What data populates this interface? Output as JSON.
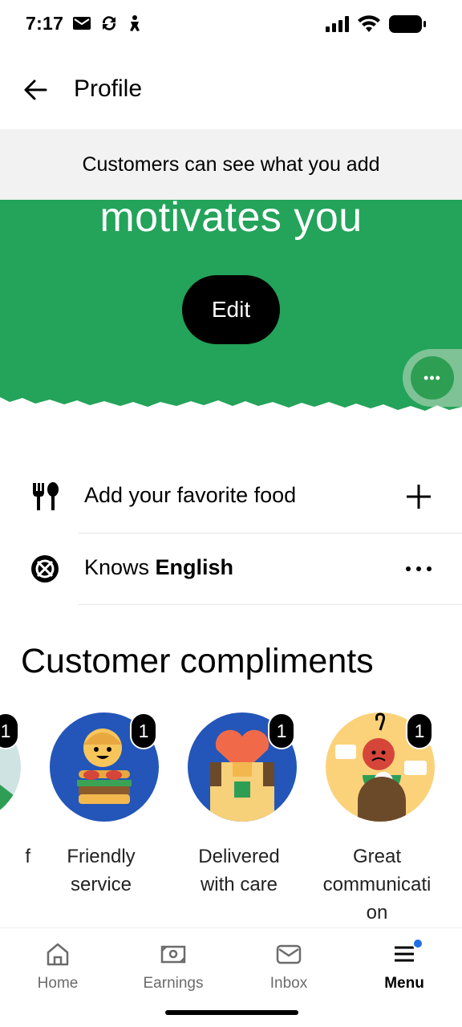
{
  "status_bar": {
    "time": "7:17",
    "left_icons": [
      "mail-icon",
      "sync-icon",
      "accessibility-icon"
    ],
    "right_icons": [
      "signal-icon",
      "wifi-icon",
      "battery-icon"
    ]
  },
  "header": {
    "title": "Profile"
  },
  "notice": {
    "text": "Customers can see what you add"
  },
  "hero": {
    "text": "motivates you",
    "edit_label": "Edit",
    "background_color": "#24a35a",
    "more_label": "•••"
  },
  "rows": [
    {
      "icon": "fork-spoon-icon",
      "label": "Add your favorite food",
      "label_bold": "",
      "action_icon": "plus-icon"
    },
    {
      "icon": "language-icon",
      "label": "Knows ",
      "label_bold": "English",
      "action_icon": "more-horizontal-icon"
    }
  ],
  "compliments": {
    "title": "Customer compliments",
    "items": [
      {
        "label": "",
        "count": "1",
        "color": "#cfe3e3"
      },
      {
        "label": "Friendly service",
        "count": "1",
        "color": "#2356b8"
      },
      {
        "label": "Delivered with care",
        "count": "1",
        "color": "#2356b8"
      },
      {
        "label": "Great communication",
        "count": "1",
        "color": "#fbd27a"
      }
    ],
    "cut_label_tail": "f"
  },
  "bottom_nav": {
    "items": [
      {
        "label": "Home",
        "icon": "home-icon",
        "active": false
      },
      {
        "label": "Earnings",
        "icon": "earnings-icon",
        "active": false
      },
      {
        "label": "Inbox",
        "icon": "inbox-icon",
        "active": false
      },
      {
        "label": "Menu",
        "icon": "menu-icon",
        "active": true
      }
    ],
    "notification_color": "#1f6fe5"
  }
}
